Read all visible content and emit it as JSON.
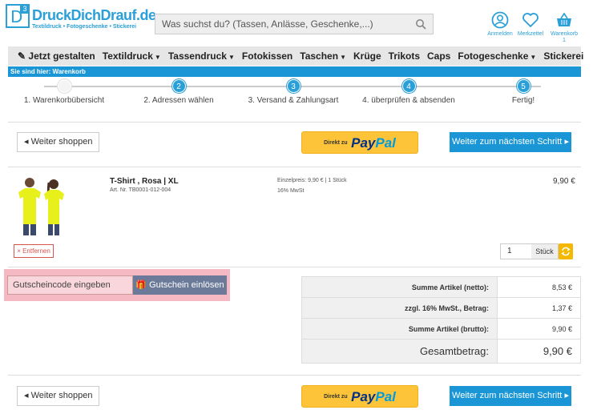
{
  "header": {
    "logo_letter": "D",
    "logo_number": "3",
    "logo_name": "DruckDichDrauf.de",
    "logo_tagline": "Textildruck • Fotogeschenke • Stickerei",
    "search_placeholder": "Was suchst du? (Tassen, Anlässe, Geschenke,...)",
    "account_label": "Anmelden",
    "wishlist_label": "Merkzettel",
    "cart_label": "Warenkorb",
    "cart_count": "1"
  },
  "nav": {
    "items": [
      {
        "label": "Jetzt gestalten",
        "icon": "pencil-icon"
      },
      {
        "label": "Textildruck",
        "has_dropdown": true
      },
      {
        "label": "Tassendruck",
        "has_dropdown": true
      },
      {
        "label": "Fotokissen"
      },
      {
        "label": "Taschen",
        "has_dropdown": true
      },
      {
        "label": "Krüge"
      },
      {
        "label": "Trikots"
      },
      {
        "label": "Caps"
      },
      {
        "label": "Fotogeschenke",
        "has_dropdown": true
      },
      {
        "label": "Stickerei"
      }
    ]
  },
  "breadcrumb": "Sie sind hier: Warenkorb",
  "steps": [
    {
      "num": "1",
      "label": "1. Warenkorbübersicht",
      "done": true
    },
    {
      "num": "2",
      "label": "2. Adressen wählen"
    },
    {
      "num": "3",
      "label": "3. Versand & Zahlungsart"
    },
    {
      "num": "4",
      "label": "4. überprüfen & absenden"
    },
    {
      "num": "5",
      "label": "Fertig!"
    }
  ],
  "actions": {
    "continue_shopping": "Weiter shoppen",
    "paypal_prefix": "Direkt zu",
    "paypal_pay": "Pay",
    "paypal_pal": "Pal",
    "next_step": "Weiter zum nächsten Schritt"
  },
  "product": {
    "title": "T-Shirt , Rosa | XL",
    "article": "Art. Nr. TB0001-012-004",
    "unit_price": "Einzelpreis: 9,90 € | 1 Stück",
    "tax": "16% MwSt",
    "price": "9,90 €",
    "remove_label": "Entfernen",
    "quantity": "1",
    "unit": "Stück"
  },
  "voucher": {
    "placeholder": "Gutscheincode eingeben",
    "button": "Gutschein einlösen"
  },
  "totals": [
    {
      "label": "Summe Artikel (netto):",
      "value": "8,53 €"
    },
    {
      "label": "zzgl. 16% MwSt., Betrag:",
      "value": "1,37 €"
    },
    {
      "label": "Summe Artikel (brutto):",
      "value": "9,90 €"
    },
    {
      "label": "Gesamtbetrag:",
      "value": "9,90 €",
      "grand": true
    }
  ],
  "colors": {
    "brand_blue": "#1a96d6",
    "paypal_yellow": "#fdc43a",
    "voucher_highlight": "#f4b9c3",
    "voucher_button": "#6b7a99",
    "remove_red": "#d9534f"
  }
}
